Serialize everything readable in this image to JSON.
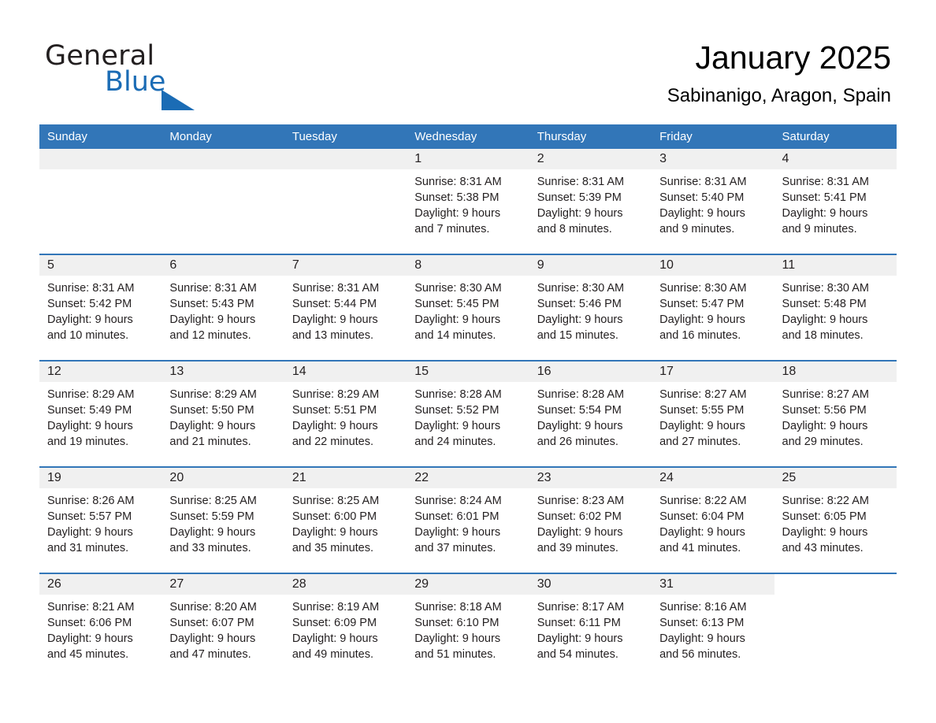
{
  "brand": {
    "word_one": "General",
    "word_two": "Blue",
    "triangle_icon": "triangle-icon",
    "colors": {
      "blue": "#1b6cb5",
      "black": "#231f20"
    }
  },
  "header": {
    "title": "January 2025",
    "location": "Sabinanigo, Aragon, Spain"
  },
  "theme": {
    "header_blue": "#3276b8",
    "daynum_band": "#f0f0f0",
    "text": "#231f20"
  },
  "weekday_headers": [
    "Sunday",
    "Monday",
    "Tuesday",
    "Wednesday",
    "Thursday",
    "Friday",
    "Saturday"
  ],
  "weeks": [
    {
      "days": [
        {
          "date": "",
          "blank": true,
          "sunrise": "",
          "sunset": "",
          "daylight_line1": "",
          "daylight_line2": ""
        },
        {
          "date": "",
          "blank": true,
          "sunrise": "",
          "sunset": "",
          "daylight_line1": "",
          "daylight_line2": ""
        },
        {
          "date": "",
          "blank": true,
          "sunrise": "",
          "sunset": "",
          "daylight_line1": "",
          "daylight_line2": ""
        },
        {
          "date": "1",
          "sunrise": "Sunrise: 8:31 AM",
          "sunset": "Sunset: 5:38 PM",
          "daylight_line1": "Daylight: 9 hours",
          "daylight_line2": "and 7 minutes."
        },
        {
          "date": "2",
          "sunrise": "Sunrise: 8:31 AM",
          "sunset": "Sunset: 5:39 PM",
          "daylight_line1": "Daylight: 9 hours",
          "daylight_line2": "and 8 minutes."
        },
        {
          "date": "3",
          "sunrise": "Sunrise: 8:31 AM",
          "sunset": "Sunset: 5:40 PM",
          "daylight_line1": "Daylight: 9 hours",
          "daylight_line2": "and 9 minutes."
        },
        {
          "date": "4",
          "sunrise": "Sunrise: 8:31 AM",
          "sunset": "Sunset: 5:41 PM",
          "daylight_line1": "Daylight: 9 hours",
          "daylight_line2": "and 9 minutes."
        }
      ]
    },
    {
      "days": [
        {
          "date": "5",
          "sunrise": "Sunrise: 8:31 AM",
          "sunset": "Sunset: 5:42 PM",
          "daylight_line1": "Daylight: 9 hours",
          "daylight_line2": "and 10 minutes."
        },
        {
          "date": "6",
          "sunrise": "Sunrise: 8:31 AM",
          "sunset": "Sunset: 5:43 PM",
          "daylight_line1": "Daylight: 9 hours",
          "daylight_line2": "and 12 minutes."
        },
        {
          "date": "7",
          "sunrise": "Sunrise: 8:31 AM",
          "sunset": "Sunset: 5:44 PM",
          "daylight_line1": "Daylight: 9 hours",
          "daylight_line2": "and 13 minutes."
        },
        {
          "date": "8",
          "sunrise": "Sunrise: 8:30 AM",
          "sunset": "Sunset: 5:45 PM",
          "daylight_line1": "Daylight: 9 hours",
          "daylight_line2": "and 14 minutes."
        },
        {
          "date": "9",
          "sunrise": "Sunrise: 8:30 AM",
          "sunset": "Sunset: 5:46 PM",
          "daylight_line1": "Daylight: 9 hours",
          "daylight_line2": "and 15 minutes."
        },
        {
          "date": "10",
          "sunrise": "Sunrise: 8:30 AM",
          "sunset": "Sunset: 5:47 PM",
          "daylight_line1": "Daylight: 9 hours",
          "daylight_line2": "and 16 minutes."
        },
        {
          "date": "11",
          "sunrise": "Sunrise: 8:30 AM",
          "sunset": "Sunset: 5:48 PM",
          "daylight_line1": "Daylight: 9 hours",
          "daylight_line2": "and 18 minutes."
        }
      ]
    },
    {
      "days": [
        {
          "date": "12",
          "sunrise": "Sunrise: 8:29 AM",
          "sunset": "Sunset: 5:49 PM",
          "daylight_line1": "Daylight: 9 hours",
          "daylight_line2": "and 19 minutes."
        },
        {
          "date": "13",
          "sunrise": "Sunrise: 8:29 AM",
          "sunset": "Sunset: 5:50 PM",
          "daylight_line1": "Daylight: 9 hours",
          "daylight_line2": "and 21 minutes."
        },
        {
          "date": "14",
          "sunrise": "Sunrise: 8:29 AM",
          "sunset": "Sunset: 5:51 PM",
          "daylight_line1": "Daylight: 9 hours",
          "daylight_line2": "and 22 minutes."
        },
        {
          "date": "15",
          "sunrise": "Sunrise: 8:28 AM",
          "sunset": "Sunset: 5:52 PM",
          "daylight_line1": "Daylight: 9 hours",
          "daylight_line2": "and 24 minutes."
        },
        {
          "date": "16",
          "sunrise": "Sunrise: 8:28 AM",
          "sunset": "Sunset: 5:54 PM",
          "daylight_line1": "Daylight: 9 hours",
          "daylight_line2": "and 26 minutes."
        },
        {
          "date": "17",
          "sunrise": "Sunrise: 8:27 AM",
          "sunset": "Sunset: 5:55 PM",
          "daylight_line1": "Daylight: 9 hours",
          "daylight_line2": "and 27 minutes."
        },
        {
          "date": "18",
          "sunrise": "Sunrise: 8:27 AM",
          "sunset": "Sunset: 5:56 PM",
          "daylight_line1": "Daylight: 9 hours",
          "daylight_line2": "and 29 minutes."
        }
      ]
    },
    {
      "days": [
        {
          "date": "19",
          "sunrise": "Sunrise: 8:26 AM",
          "sunset": "Sunset: 5:57 PM",
          "daylight_line1": "Daylight: 9 hours",
          "daylight_line2": "and 31 minutes."
        },
        {
          "date": "20",
          "sunrise": "Sunrise: 8:25 AM",
          "sunset": "Sunset: 5:59 PM",
          "daylight_line1": "Daylight: 9 hours",
          "daylight_line2": "and 33 minutes."
        },
        {
          "date": "21",
          "sunrise": "Sunrise: 8:25 AM",
          "sunset": "Sunset: 6:00 PM",
          "daylight_line1": "Daylight: 9 hours",
          "daylight_line2": "and 35 minutes."
        },
        {
          "date": "22",
          "sunrise": "Sunrise: 8:24 AM",
          "sunset": "Sunset: 6:01 PM",
          "daylight_line1": "Daylight: 9 hours",
          "daylight_line2": "and 37 minutes."
        },
        {
          "date": "23",
          "sunrise": "Sunrise: 8:23 AM",
          "sunset": "Sunset: 6:02 PM",
          "daylight_line1": "Daylight: 9 hours",
          "daylight_line2": "and 39 minutes."
        },
        {
          "date": "24",
          "sunrise": "Sunrise: 8:22 AM",
          "sunset": "Sunset: 6:04 PM",
          "daylight_line1": "Daylight: 9 hours",
          "daylight_line2": "and 41 minutes."
        },
        {
          "date": "25",
          "sunrise": "Sunrise: 8:22 AM",
          "sunset": "Sunset: 6:05 PM",
          "daylight_line1": "Daylight: 9 hours",
          "daylight_line2": "and 43 minutes."
        }
      ]
    },
    {
      "days": [
        {
          "date": "26",
          "sunrise": "Sunrise: 8:21 AM",
          "sunset": "Sunset: 6:06 PM",
          "daylight_line1": "Daylight: 9 hours",
          "daylight_line2": "and 45 minutes."
        },
        {
          "date": "27",
          "sunrise": "Sunrise: 8:20 AM",
          "sunset": "Sunset: 6:07 PM",
          "daylight_line1": "Daylight: 9 hours",
          "daylight_line2": "and 47 minutes."
        },
        {
          "date": "28",
          "sunrise": "Sunrise: 8:19 AM",
          "sunset": "Sunset: 6:09 PM",
          "daylight_line1": "Daylight: 9 hours",
          "daylight_line2": "and 49 minutes."
        },
        {
          "date": "29",
          "sunrise": "Sunrise: 8:18 AM",
          "sunset": "Sunset: 6:10 PM",
          "daylight_line1": "Daylight: 9 hours",
          "daylight_line2": "and 51 minutes."
        },
        {
          "date": "30",
          "sunrise": "Sunrise: 8:17 AM",
          "sunset": "Sunset: 6:11 PM",
          "daylight_line1": "Daylight: 9 hours",
          "daylight_line2": "and 54 minutes."
        },
        {
          "date": "31",
          "sunrise": "Sunrise: 8:16 AM",
          "sunset": "Sunset: 6:13 PM",
          "daylight_line1": "Daylight: 9 hours",
          "daylight_line2": "and 56 minutes."
        },
        {
          "date": "",
          "blank": true,
          "sunrise": "",
          "sunset": "",
          "daylight_line1": "",
          "daylight_line2": ""
        }
      ]
    }
  ]
}
